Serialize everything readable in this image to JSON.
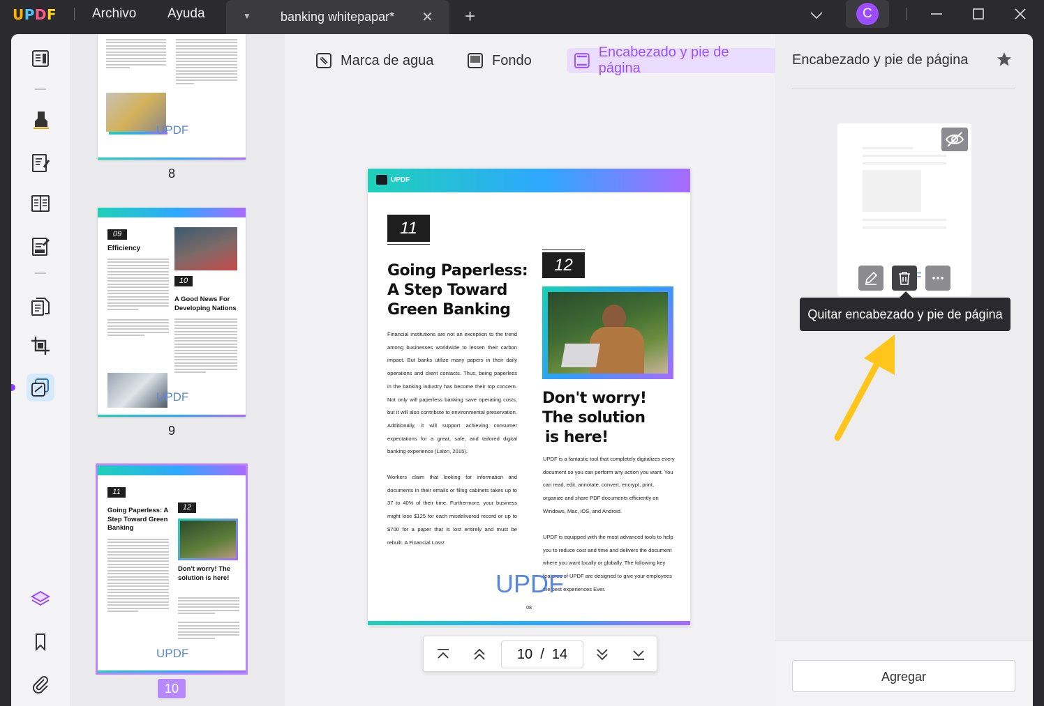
{
  "app": {
    "logo": "UPDF",
    "menu": [
      "Archivo",
      "Ayuda"
    ],
    "tab_title": "banking whitepapar*",
    "avatar_letter": "C"
  },
  "thumbnails": {
    "pages": [
      {
        "label": "8",
        "watermark": "UPDF",
        "selected": false
      },
      {
        "label": "9",
        "watermark": "UPDF",
        "selected": false,
        "num_a": "09",
        "title_a": "Efficiency",
        "num_b": "10",
        "title_b": "A Good News For Developing Nations"
      },
      {
        "label": "10",
        "watermark": "UPDF",
        "selected": true,
        "num_a": "11",
        "title_a": "Going Paperless: A Step Toward Green Banking",
        "num_b": "12",
        "title_b": "Don't worry! The solution is here!"
      }
    ]
  },
  "toolbar_tabs": {
    "watermark": "Marca de agua",
    "background": "Fondo",
    "header_footer": "Encabezado y pie de página"
  },
  "page": {
    "header_logo": "UPDF",
    "num_left": "11",
    "num_right": "12",
    "heading_left_1": "Going Paperless:",
    "heading_left_2": "A Step Toward",
    "heading_left_3": "Green Banking",
    "body_left": "Financial institutions are not an exception to the trend among businesses worldwide to lessen their carbon impact. But banks utilize many papers in their daily operations and client contacts. Thus, being paperless in the banking industry has become their top concern. Not only will paperless banking save operating costs, but it will also contribute to environmental preservation. Additionally, it will support achieving consumer expectations for a great, safe, and tailored digital banking experience (Lalon, 2015).",
    "body_left_2": "Workers claim that looking for information and documents in their emails or filing cabinets takes up to 37 to 40% of their time. Furthermore, your business might lose $125 for each misdelivered record or up to $700 for a paper that is lost entirely and must be rebuilt. A Financial Loss!",
    "heading_right_1": "Don't worry!",
    "heading_right_2": "The solution",
    "heading_right_3": "is here!",
    "body_right": "UPDF is a fantastic tool that completely digitalizes every document so you can perform any action you want. You can read, edit, annotate, convert, encrypt, print, organize and share PDF documents efficiently on Windows, Mac, iOS, and Android.",
    "body_right_2": "UPDF is equipped with the most advanced tools to help you to reduce cost and time and delivers the document where you want locally or globally. The following key features of UPDF are designed to give your employees the best experiences Ever.",
    "watermark": "UPDF",
    "page_number": "08"
  },
  "pager": {
    "current": "10",
    "separator": "/",
    "total": "14"
  },
  "right_panel": {
    "title": "Encabezado y pie de página",
    "tooltip": "Quitar encabezado y pie de página",
    "add_button": "Agregar",
    "card_watermark": "UPDF"
  },
  "colors": {
    "accent": "#9b4dff",
    "active_tab_bg": "#e9dcff",
    "arrow": "#ffc51a",
    "watermark": "#4f7fe0"
  }
}
